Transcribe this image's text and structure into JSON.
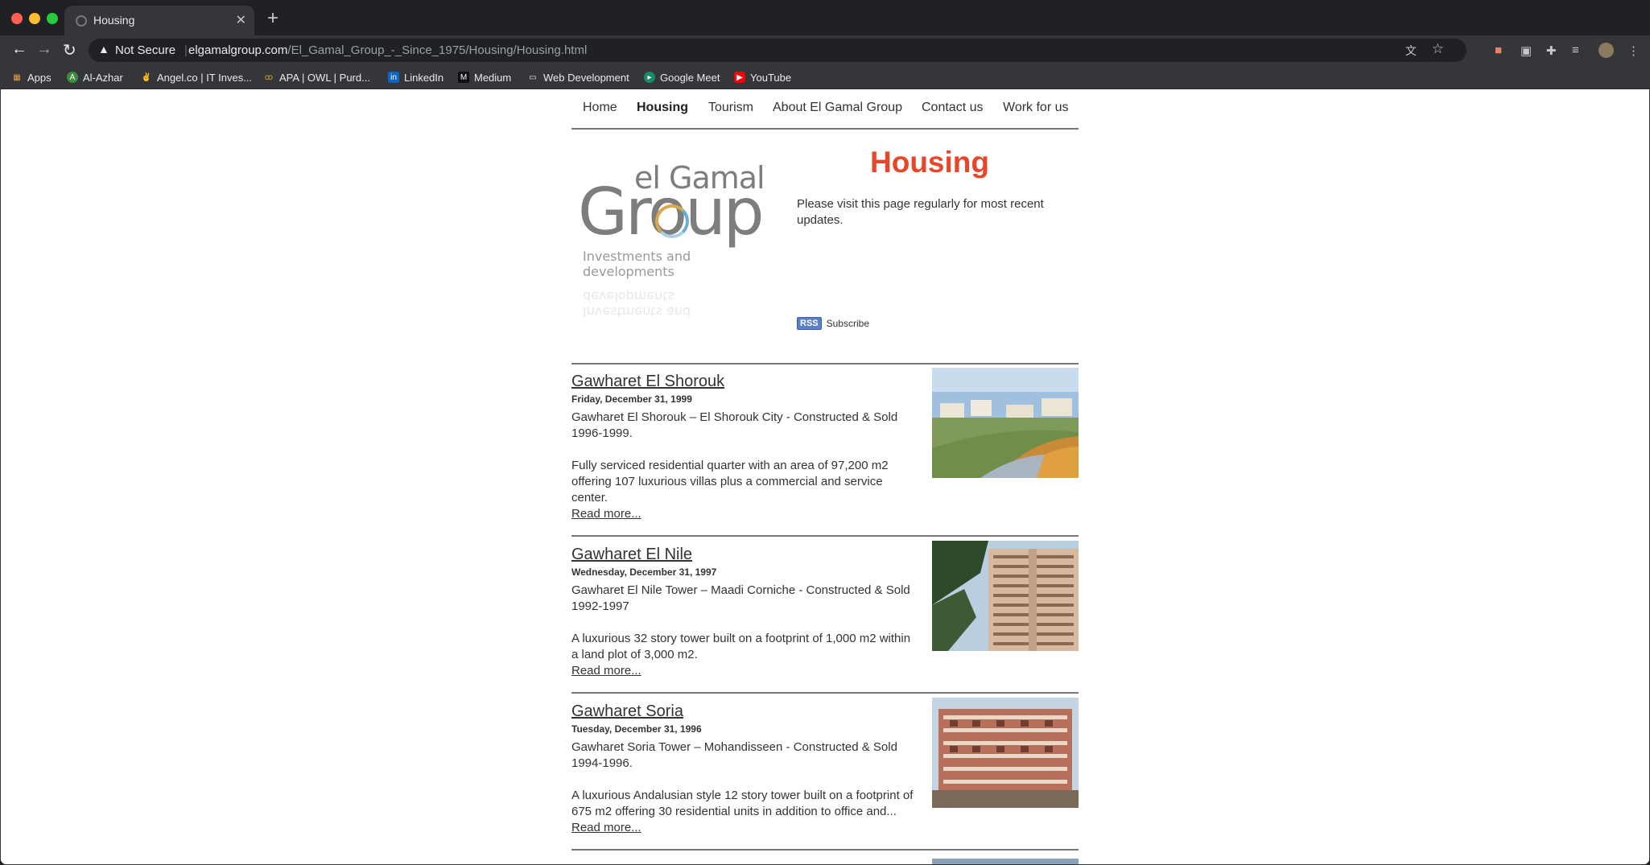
{
  "browser": {
    "tab_title": "Housing",
    "security_label": "Not Secure",
    "url_domain": "elgamalgroup.com",
    "url_path": "/El_Gamal_Group_-_Since_1975/Housing/Housing.html"
  },
  "bookmarks": [
    {
      "label": "Apps",
      "icon": "apps-grid-icon"
    },
    {
      "label": "Al-Azhar",
      "icon": "al-azhar-icon"
    },
    {
      "label": "Angel.co | IT Inves...",
      "icon": "angel-icon"
    },
    {
      "label": "APA | OWL | Purd...",
      "icon": "owl-icon"
    },
    {
      "label": "LinkedIn",
      "icon": "linkedin-icon"
    },
    {
      "label": "Medium",
      "icon": "medium-icon"
    },
    {
      "label": "Web Development",
      "icon": "folder-icon"
    },
    {
      "label": "Google Meet",
      "icon": "google-meet-icon"
    },
    {
      "label": "YouTube",
      "icon": "youtube-icon"
    }
  ],
  "nav": {
    "home": "Home",
    "housing": "Housing",
    "tourism": "Tourism",
    "about": "About El Gamal Group",
    "contact": "Contact us",
    "work": "Work for us"
  },
  "logo": {
    "line1": "el Gamal",
    "line2": "Group",
    "tagline": "Investments and developments"
  },
  "page": {
    "title": "Housing",
    "intro": "Please visit this page regularly for most recent updates.",
    "rss_badge": "RSS",
    "rss_label": "Subscribe"
  },
  "articles": [
    {
      "title": "Gawharet El Shorouk",
      "date": "Friday, December 31, 1999",
      "para1": "Gawharet El Shorouk – El Shorouk City - Constructed & Sold 1996-1999.",
      "para2": "Fully serviced residential quarter with an area of 97,200 m2 offering 107 luxurious villas plus a commercial and service center.",
      "more": "Read more..."
    },
    {
      "title": "Gawharet El Nile",
      "date": "Wednesday, December 31, 1997",
      "para1": "Gawharet El Nile Tower – Maadi Corniche - Constructed & Sold 1992-1997",
      "para2": "A luxurious 32 story tower built on a footprint of 1,000 m2 within a land plot of 3,000 m2.",
      "more": "Read more..."
    },
    {
      "title": "Gawharet Soria",
      "date": "Tuesday, December 31, 1996",
      "para1": "Gawharet Soria Tower – Mohandisseen - Constructed & Sold 1994-1996.",
      "para2": "A luxurious Andalusian style 12 story tower built on a footprint of 675 m2 offering 30 residential units in addition to office and...",
      "more": "Read more..."
    }
  ],
  "colors": {
    "title_red": "#e8462b",
    "chrome_dark": "#202124",
    "chrome_toolbar": "#35363a"
  }
}
